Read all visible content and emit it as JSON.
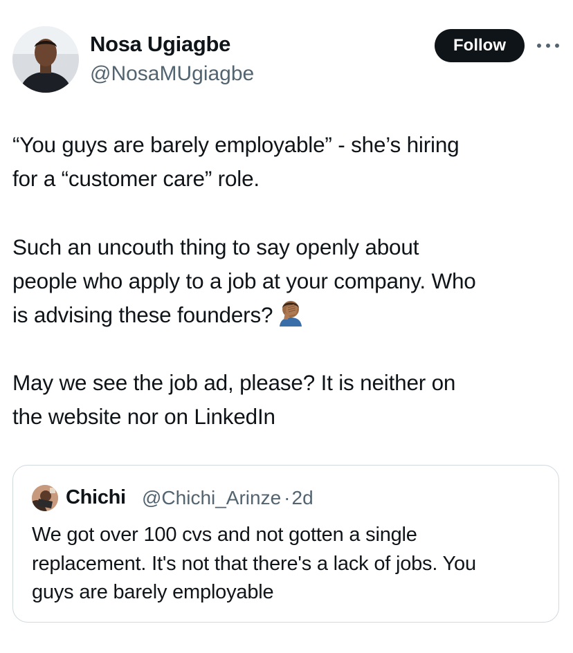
{
  "author": {
    "name": "Nosa Ugiagbe",
    "handle": "@NosaMUgiagbe",
    "avatar_icon": "profile-photo"
  },
  "actions": {
    "follow_label": "Follow",
    "more_icon": "more-horizontal-icon"
  },
  "tweet": {
    "paragraphs": [
      [
        "“You guys are barely employable” - she’s hiring",
        "for a “customer care” role."
      ],
      [
        "Such an uncouth thing to say openly about",
        "people who apply to a job at your company. Who",
        "is advising these founders?"
      ],
      [
        "May we see the job ad, please? It is neither on",
        "the website nor on LinkedIn"
      ]
    ],
    "emoji": "facepalm-emoji"
  },
  "quoted": {
    "name": "Chichi",
    "handle": "@Chichi_Arinze",
    "separator": "·",
    "time": "2d",
    "lines": [
      "We got over 100 cvs and not gotten a single",
      "replacement. It's not that there's a lack of jobs. You",
      "guys are barely employable"
    ]
  },
  "colors": {
    "text": "#0f1419",
    "secondary": "#536471",
    "border": "#cfd9de",
    "button": "#0f1419"
  }
}
